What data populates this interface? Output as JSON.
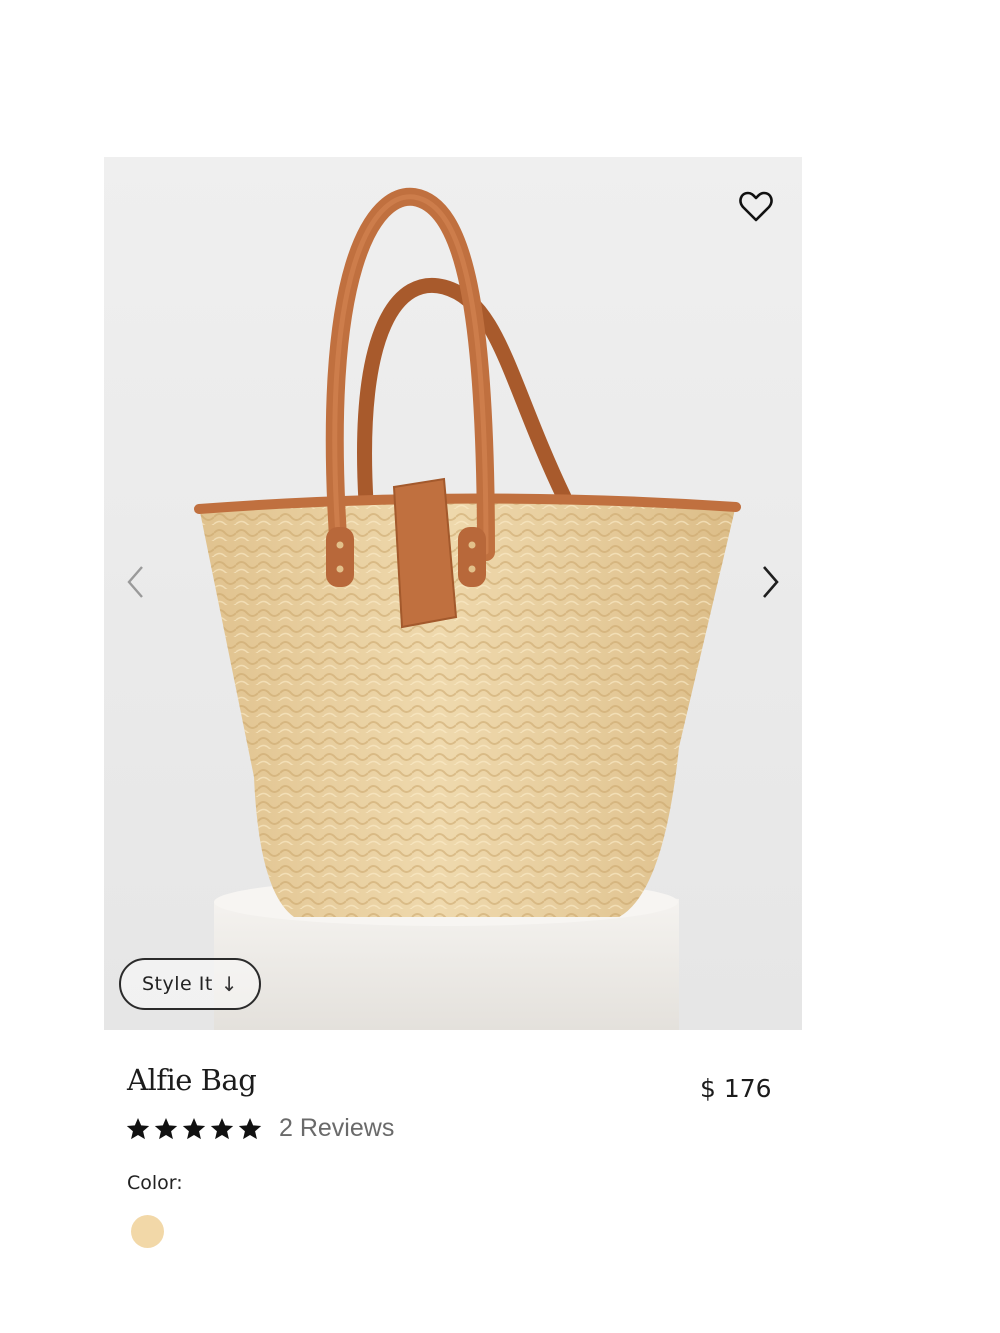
{
  "product": {
    "title": "Alfie Bag",
    "price": "$ 176",
    "rating": 5,
    "rating_max": 5,
    "reviews_label": "2 Reviews",
    "color_label": "Color:",
    "swatch_color": "#f2d8a8"
  },
  "gallery": {
    "style_it_label": "Style It",
    "style_it_icon": "arrow-down-icon",
    "wishlist_icon": "heart-icon",
    "prev_icon": "chevron-left-icon",
    "next_icon": "chevron-right-icon"
  },
  "colors": {
    "leather": "#c0703f",
    "straw": "#e8cd9a",
    "background": "#ececec"
  }
}
